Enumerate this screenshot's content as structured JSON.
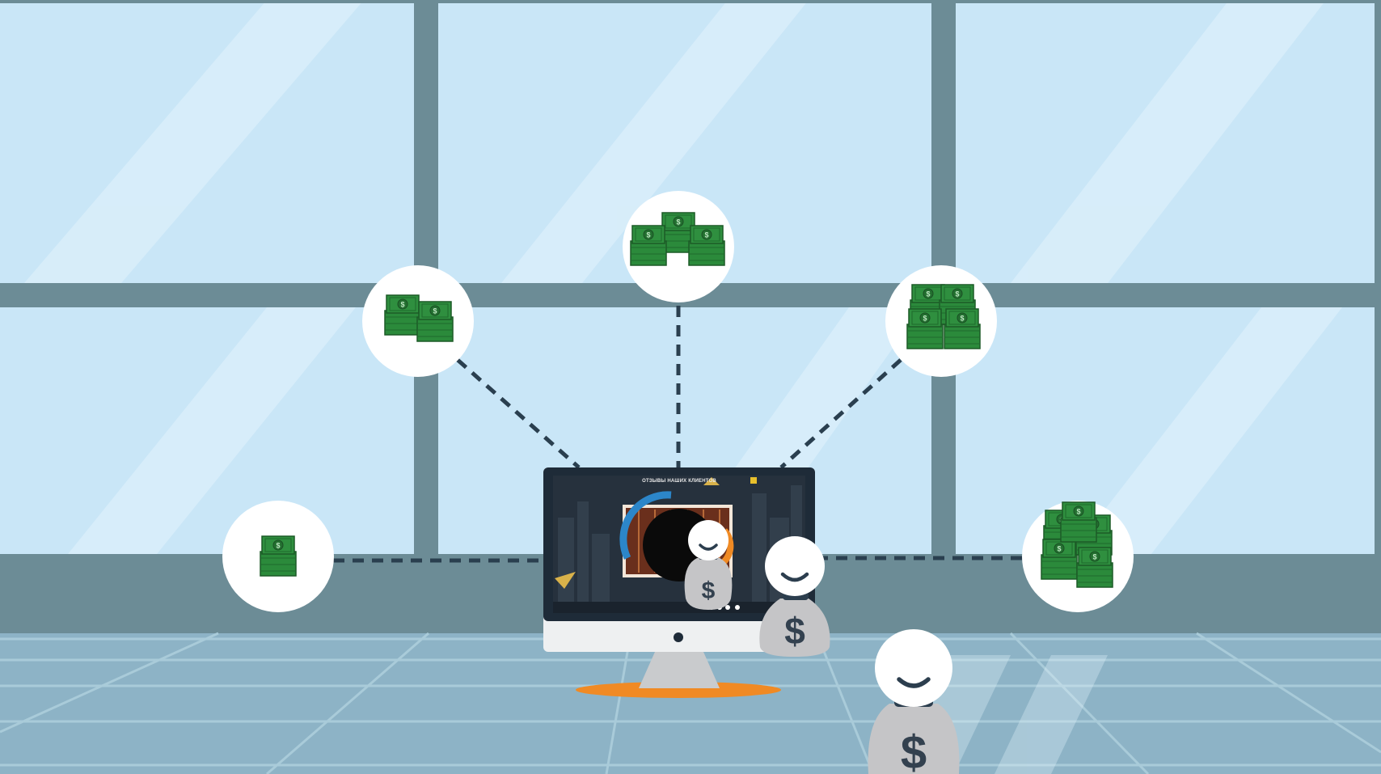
{
  "scene": {
    "type": "illustration",
    "colors": {
      "sky": "#c9e6f7",
      "frame": "#6c8c96",
      "floor": "#8db3c6",
      "money": "#2e8a3e",
      "bag": "#c5c5c7",
      "accent": "#f08a24"
    }
  },
  "monitor": {
    "screen_title": "ОТЗЫВЫ НАШИХ КЛИЕНТОВ"
  },
  "money_nodes": [
    {
      "id": "node-1",
      "stacks": 1
    },
    {
      "id": "node-2",
      "stacks": 2
    },
    {
      "id": "node-3",
      "stacks": 3
    },
    {
      "id": "node-4",
      "stacks": 4
    },
    {
      "id": "node-5",
      "stacks": 5
    }
  ],
  "figures": [
    {
      "id": "bag-small",
      "symbol": "$"
    },
    {
      "id": "bag-medium",
      "symbol": "$"
    },
    {
      "id": "bag-large",
      "symbol": "$"
    }
  ]
}
